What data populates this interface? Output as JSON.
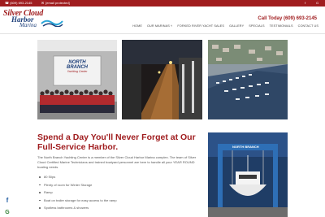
{
  "topbar": {
    "phone": "(609) 693-2145",
    "email": "[email protected]",
    "icons": [
      "facebook-icon",
      "google-icon"
    ]
  },
  "logo": {
    "line1": "Silver Cloud",
    "line2": "Harbor",
    "line3": "Marina"
  },
  "header": {
    "call_label": "Call Today (609) 693-2145"
  },
  "nav": {
    "items": [
      "HOME",
      "OUR MARINAS",
      "FORKED RIVER YACHT SALES",
      "GALLERY",
      "SPECIALS",
      "TESTIMONIALS",
      "CONTACT US"
    ]
  },
  "photos": {
    "p1_sign_line1": "NORTH",
    "p1_sign_line2": "BRANCH",
    "p1_sign_line3": "Yachting Center",
    "p4_text": "NORTH BRANCH"
  },
  "content": {
    "heading": "Spend a Day You'll Never Forget at Our Full-Service Harbor.",
    "paragraph": "The North Branch Yachting Center is a member of the Silver Cloud Harbor Marina complex. The team of Silver Cloud Certified Marine Technicians and trained boatyard personnel are here to handle all your YEAR ROUND boating needs.",
    "bullets": [
      "80 Slips",
      "Plenty of room for Winter Storage",
      "Ramp",
      "Boat on trailer storage for easy access to the ramp",
      "Spotless bathrooms & showers"
    ]
  },
  "colors": {
    "brand_red": "#a01d1f",
    "brand_blue": "#1d3f7a"
  }
}
